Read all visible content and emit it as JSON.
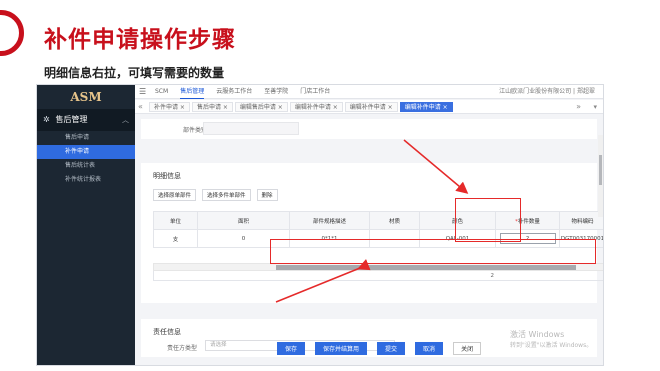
{
  "slide": {
    "title": "补件申请操作步骤",
    "subtitle": "明细信息右拉，可填写需要的数量"
  },
  "sidebar": {
    "logo": "ASM",
    "group_label": "售后管理",
    "items": [
      {
        "label": "售后申请",
        "active": false
      },
      {
        "label": "补件申请",
        "active": true
      },
      {
        "label": "售后统计表",
        "active": false
      },
      {
        "label": "补件统计报表",
        "active": false
      }
    ]
  },
  "topbar": {
    "nav": [
      "SCM",
      "售后管理",
      "云服务工作台",
      "至善学院",
      "门店工作台"
    ],
    "active_nav": "售后管理",
    "company": "江山欧派门业股份有限公司",
    "user": "郑超翠"
  },
  "tabs": [
    "补件申请 ×",
    "售后申请 ×",
    "编辑售后申请 ×",
    "编辑补件申请 ×",
    "编辑补件申请 ×",
    "编辑补件申请 ×"
  ],
  "active_tab_index": 5,
  "form": {
    "part_type_label": "部件类别"
  },
  "detail": {
    "title": "明细信息",
    "buttons": [
      "选择原单部件",
      "选择多件单部件",
      "删除"
    ],
    "columns": [
      "单位",
      "面积",
      "部件规格描述",
      "材质",
      "颜色",
      "补件数量",
      "物料编码"
    ],
    "required_column": "补件数量",
    "row": [
      "支",
      "0",
      "0*1*1",
      "",
      "QAL-001",
      "2",
      "DGT003170001"
    ],
    "footer_total": "2"
  },
  "responsibility": {
    "title": "责任信息",
    "type_label": "责任方类型",
    "type_placeholder": "请选择"
  },
  "footer_buttons": [
    "保存",
    "保存并结算用",
    "提交",
    "取消",
    "关闭"
  ],
  "watermark": {
    "line1": "激活 Windows",
    "line2": "转到\"设置\"以激活 Windows。"
  },
  "colors": {
    "accent": "#c8101c",
    "primary": "#2f6be0",
    "sidebar_bg": "#1c2733",
    "annotation": "#e52a2a"
  }
}
